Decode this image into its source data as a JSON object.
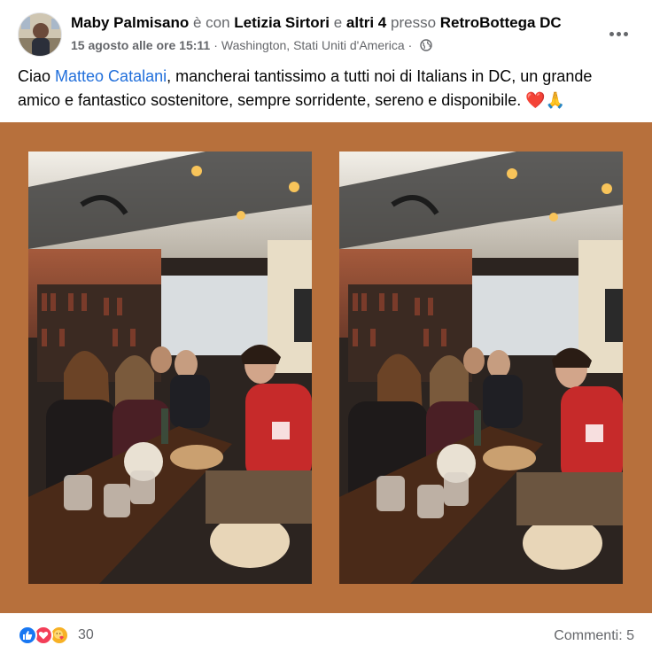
{
  "post": {
    "author": "Maby Palmisano",
    "with_word": "è con",
    "tagged": "Letizia Sirtori",
    "and_word": "e",
    "others": "altri 4",
    "at_word": "presso",
    "place": "RetroBottega DC",
    "date": "15 agosto alle ore 15:11",
    "separator": "·",
    "location": "Washington, Stati Uniti d'America",
    "text_before": "Ciao ",
    "mention": "Matteo Catalani",
    "text_after": ", mancherai tantissimo a tutti noi di Italians in DC, un grande amico e fantastico sostenitore, sempre sorridente, sereno e disponibile. ❤️🙏"
  },
  "icons": {
    "globe": "globe-icon",
    "more": "more-options-icon",
    "like": "like-reaction-icon",
    "love": "love-reaction-icon",
    "care": "care-reaction-icon"
  },
  "colors": {
    "mention": "#216fdb",
    "media_background": "#b7703c",
    "like": "#1877f2",
    "love": "#f33e58",
    "care": "#f7b125",
    "secondary_text": "#65676b"
  },
  "footer": {
    "reaction_count": "30",
    "comments": "Commenti: 5"
  }
}
